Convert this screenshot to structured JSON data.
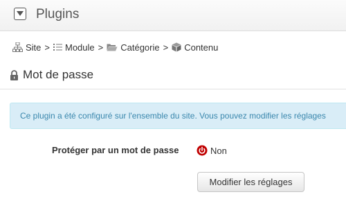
{
  "header": {
    "title": "Plugins",
    "toggle_icon": "chevron-down-icon"
  },
  "breadcrumb": {
    "items": [
      {
        "label": "Site",
        "icon": "sitemap-icon"
      },
      {
        "label": "Module",
        "icon": "list-icon"
      },
      {
        "label": "Catégorie",
        "icon": "folder-icon"
      },
      {
        "label": "Contenu",
        "icon": "cube-icon"
      }
    ],
    "separator": ">"
  },
  "section": {
    "title": "Mot de passe",
    "icon": "lock-icon"
  },
  "alert": {
    "text": "Ce plugin a été configuré sur l'ensemble du site. Vous pouvez modifier les réglages"
  },
  "form": {
    "password_label": "Protéger par un mot de passe",
    "password_status": "Non",
    "status_icon": "power-off-icon",
    "status_color": "#c00000",
    "edit_button": "Modifier les réglages"
  },
  "colors": {
    "alert_bg": "#d9edf7",
    "alert_text": "#3a87ad"
  }
}
